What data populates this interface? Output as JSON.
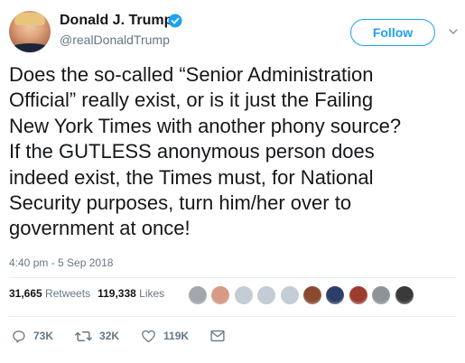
{
  "author": {
    "name": "Donald J. Trump",
    "handle": "@realDonaldTrump",
    "verified": true
  },
  "follow_label": "Follow",
  "tweet": {
    "text": "Does the so-called “Senior Administration\nOfficial” really exist, or is it just the Failing\nNew York Times with another phony source?\nIf the GUTLESS anonymous person does\nindeed exist, the Times must, for National\nSecurity purposes, turn him/her over to\ngovernment at once!",
    "timestamp": "4:40 pm - 5 Sep 2018"
  },
  "stats": {
    "retweets_count": "31,665",
    "retweets_label": "Retweets",
    "likes_count": "119,338",
    "likes_label": "Likes"
  },
  "liker_colors": [
    "#a3a7ab",
    "#d79a84",
    "#c4ccd6",
    "#c4ccd6",
    "#c4ccd6",
    "#8a4a32",
    "#2b3f69",
    "#9d3b2d",
    "#8f9398",
    "#3a3a3a"
  ],
  "actions": [
    {
      "icon": "reply-icon",
      "count": "73K"
    },
    {
      "icon": "retweet-icon",
      "count": "32K"
    },
    {
      "icon": "like-icon",
      "count": "119K"
    },
    {
      "icon": "message-icon",
      "count": ""
    }
  ],
  "colors": {
    "accent": "#1da1f2",
    "secondary_text": "#657786",
    "divider": "#e6ecf0"
  }
}
